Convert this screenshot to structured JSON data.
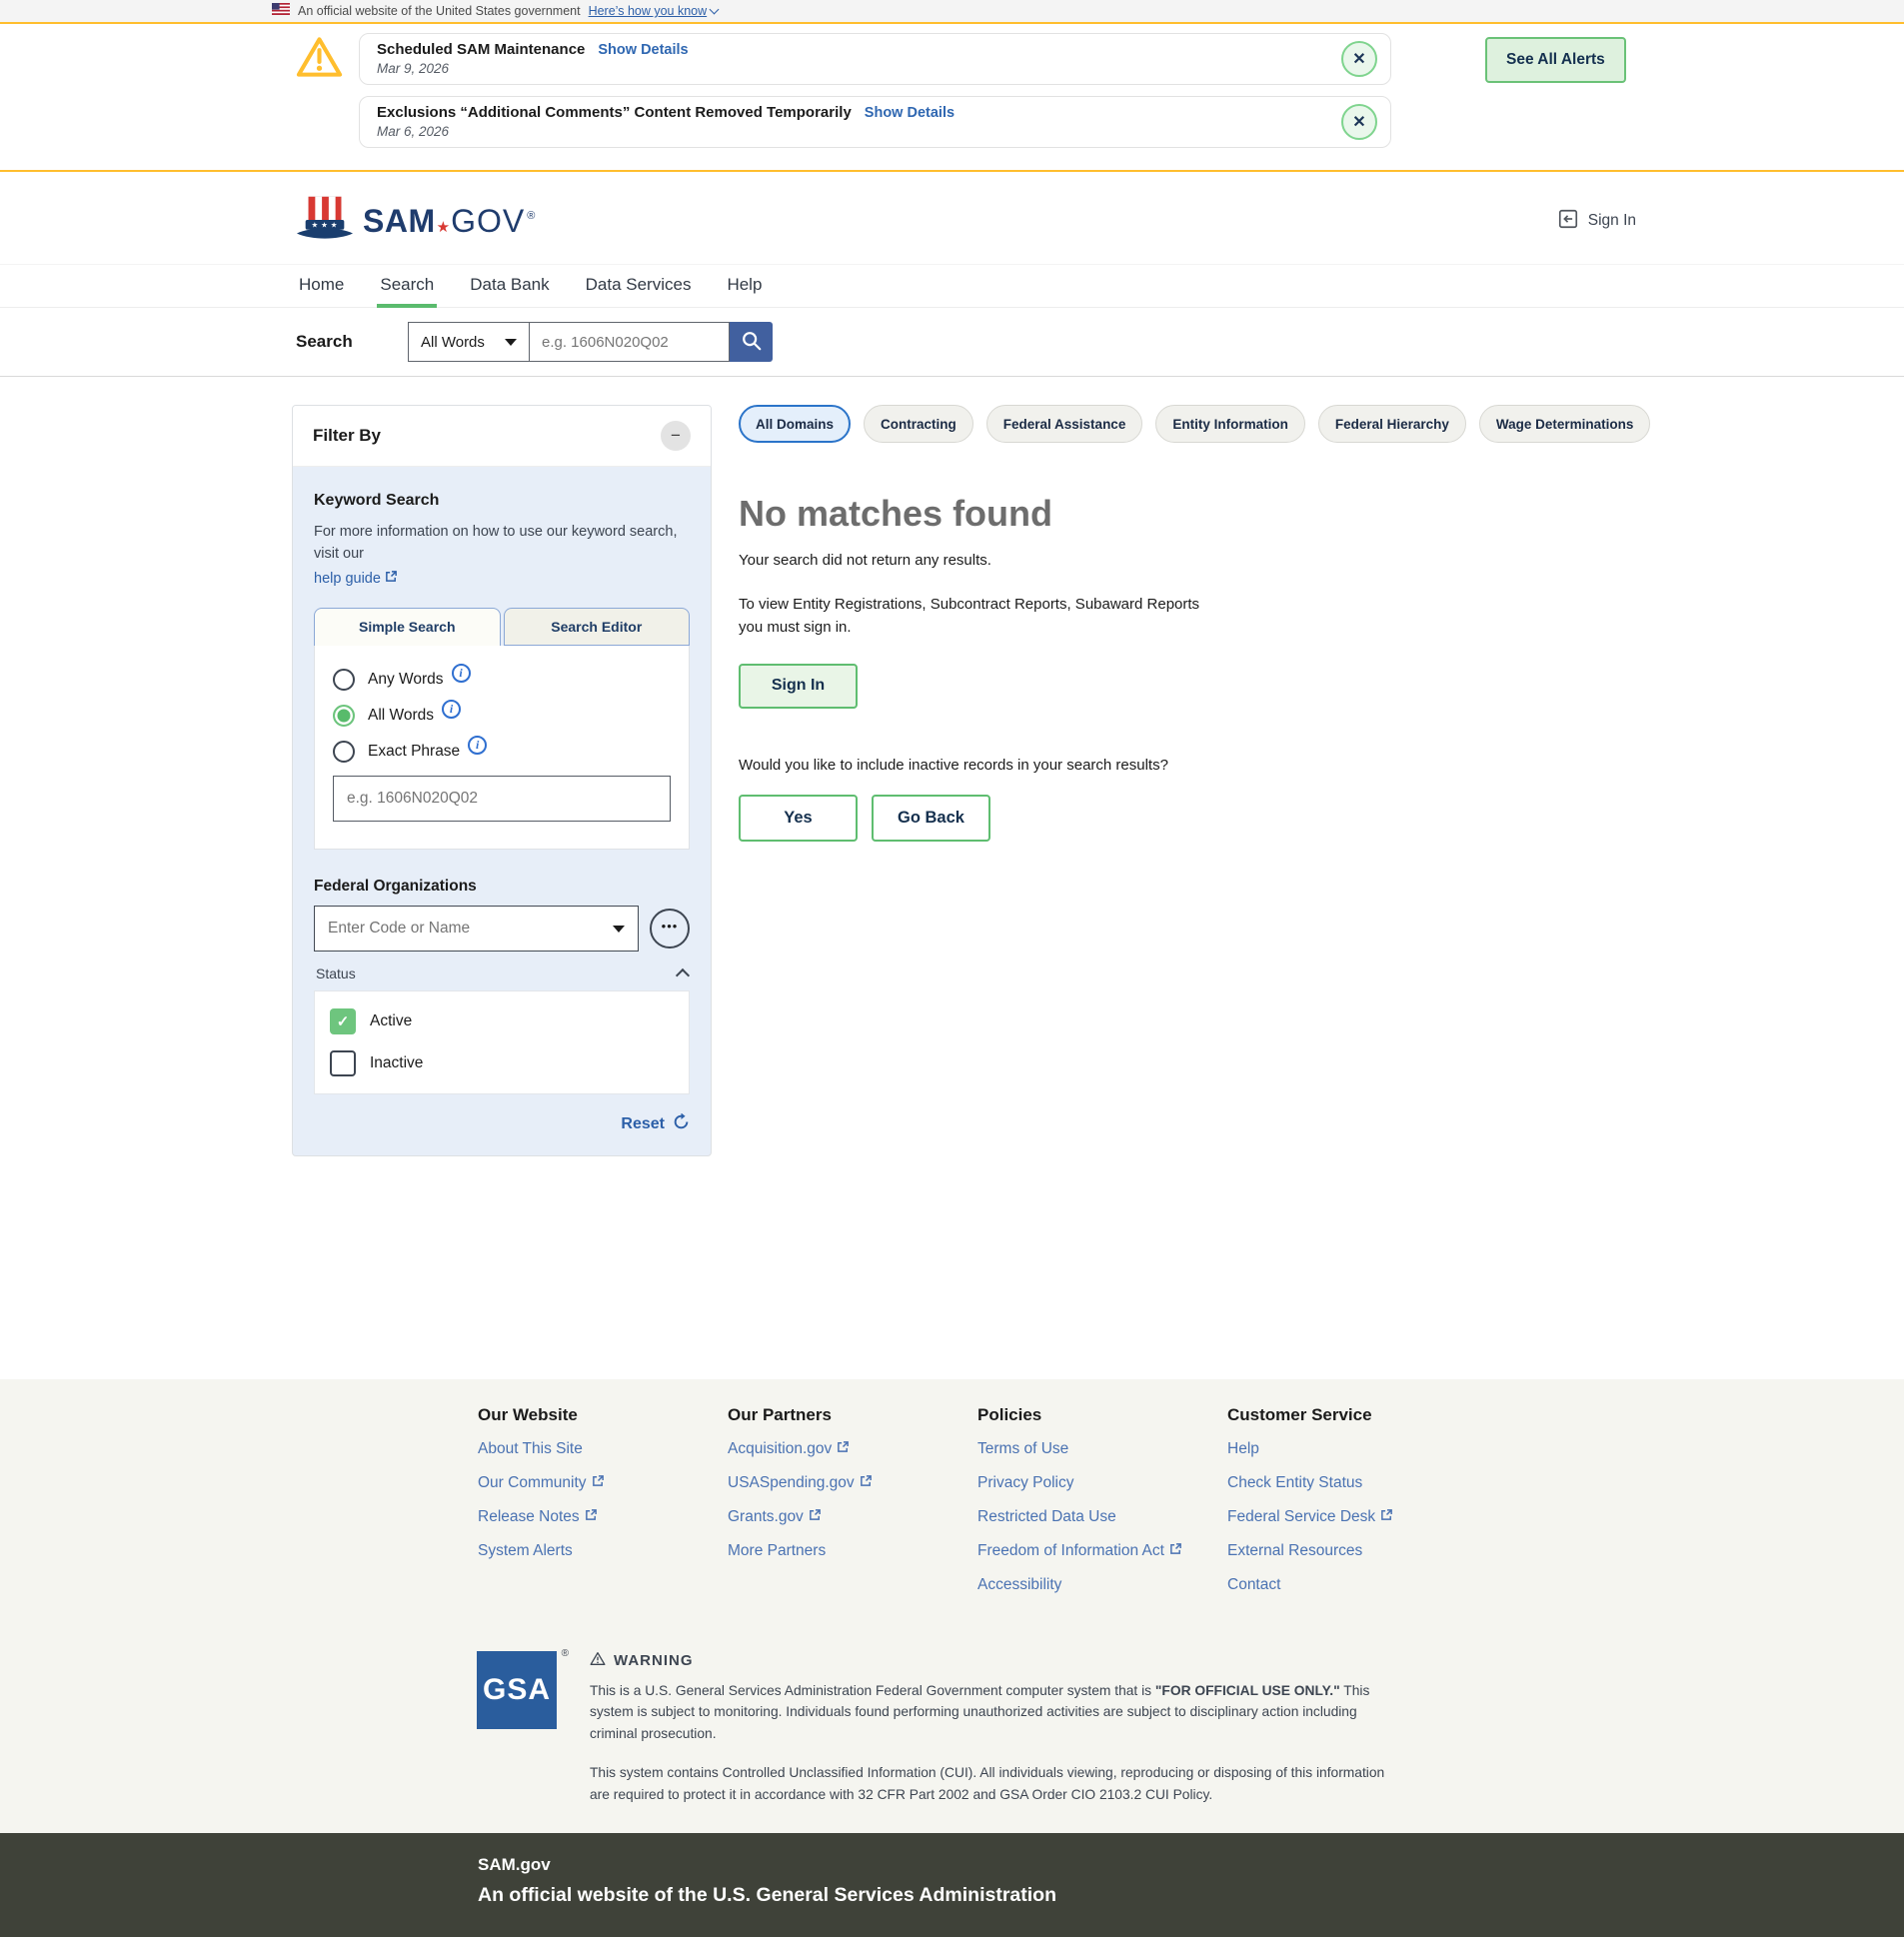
{
  "colors": {
    "gold": "#ffbe2e",
    "accent_green": "#5fbd70",
    "navy": "#1f3c6d",
    "link_blue": "#2c5fa8",
    "search_button_blue": "#41609f"
  },
  "banner": {
    "text": "An official website of the United States government",
    "link": "Here’s how you know"
  },
  "alerts": {
    "see_all": "See All Alerts",
    "items": [
      {
        "title": "Scheduled SAM Maintenance",
        "details": "Show Details",
        "date": "Mar 9, 2026"
      },
      {
        "title": "Exclusions “Additional Comments” Content Removed Temporarily",
        "details": "Show Details",
        "date": "Mar 6, 2026"
      }
    ]
  },
  "header": {
    "logo_sam": "SAM",
    "logo_star": "★",
    "logo_gov": "GOV",
    "reg": "®",
    "sign_in": "Sign In"
  },
  "nav": {
    "items": [
      "Home",
      "Search",
      "Data Bank",
      "Data Services",
      "Help"
    ]
  },
  "search_bar": {
    "label": "Search",
    "mode": "All Words",
    "placeholder": "e.g. 1606N020Q02"
  },
  "filter": {
    "title": "Filter By",
    "keyword_title": "Keyword Search",
    "keyword_help_text": "For more information on how to use our keyword search, visit our",
    "keyword_help_link": "help guide",
    "tabs": [
      "Simple Search",
      "Search Editor"
    ],
    "radios": [
      "Any Words",
      "All Words",
      "Exact Phrase"
    ],
    "keyword_placeholder": "e.g. 1606N020Q02",
    "fed_org_title": "Federal Organizations",
    "fed_org_placeholder": "Enter Code or Name",
    "status_label": "Status",
    "status_options": [
      "Active",
      "Inactive"
    ],
    "reset": "Reset"
  },
  "domains": [
    "All Domains",
    "Contracting",
    "Federal Assistance",
    "Entity Information",
    "Federal Hierarchy",
    "Wage Determinations"
  ],
  "results": {
    "title": "No matches found",
    "subtitle": "Your search did not return any results.",
    "signin_note": "To view Entity Registrations, Subcontract Reports, Subaward Reports you must sign in.",
    "signin_button": "Sign In",
    "inactive_question": "Would you like to include inactive records in your search results?",
    "yes_button": "Yes",
    "goback_button": "Go Back"
  },
  "footer": {
    "columns": [
      {
        "title": "Our Website",
        "links": [
          {
            "label": "About This Site"
          },
          {
            "label": "Our Community"
          },
          {
            "label": "Release Notes"
          },
          {
            "label": "System Alerts"
          }
        ]
      },
      {
        "title": "Our Partners",
        "links": [
          {
            "label": "Acquisition.gov"
          },
          {
            "label": "USASpending.gov"
          },
          {
            "label": "Grants.gov"
          },
          {
            "label": "More Partners"
          }
        ]
      },
      {
        "title": "Policies",
        "links": [
          {
            "label": "Terms of Use"
          },
          {
            "label": "Privacy Policy"
          },
          {
            "label": "Restricted Data Use"
          },
          {
            "label": "Freedom of Information Act"
          },
          {
            "label": "Accessibility"
          }
        ]
      },
      {
        "title": "Customer Service",
        "links": [
          {
            "label": "Help"
          },
          {
            "label": "Check Entity Status"
          },
          {
            "label": "Federal Service Desk"
          },
          {
            "label": "External Resources"
          },
          {
            "label": "Contact"
          }
        ]
      }
    ],
    "gsa": {
      "logo": "GSA",
      "reg": "®"
    },
    "warning": {
      "title": "WARNING",
      "p1_a": "This is a U.S. General Services Administration Federal Government computer system that is ",
      "p1_b": "\"FOR OFFICIAL USE ONLY.\"",
      "p1_c": " This system is subject to monitoring. Individuals found performing unauthorized activities are subject to disciplinary action including criminal prosecution.",
      "p2": "This system contains Controlled Unclassified Information (CUI). All individuals viewing, reproducing or disposing of this information are required to protect it in accordance with 32 CFR Part 2002 and GSA Order CIO 2103.2 CUI Policy."
    },
    "bottom": {
      "site": "SAM.gov",
      "tagline": "An official website of the U.S. General Services Administration"
    }
  }
}
